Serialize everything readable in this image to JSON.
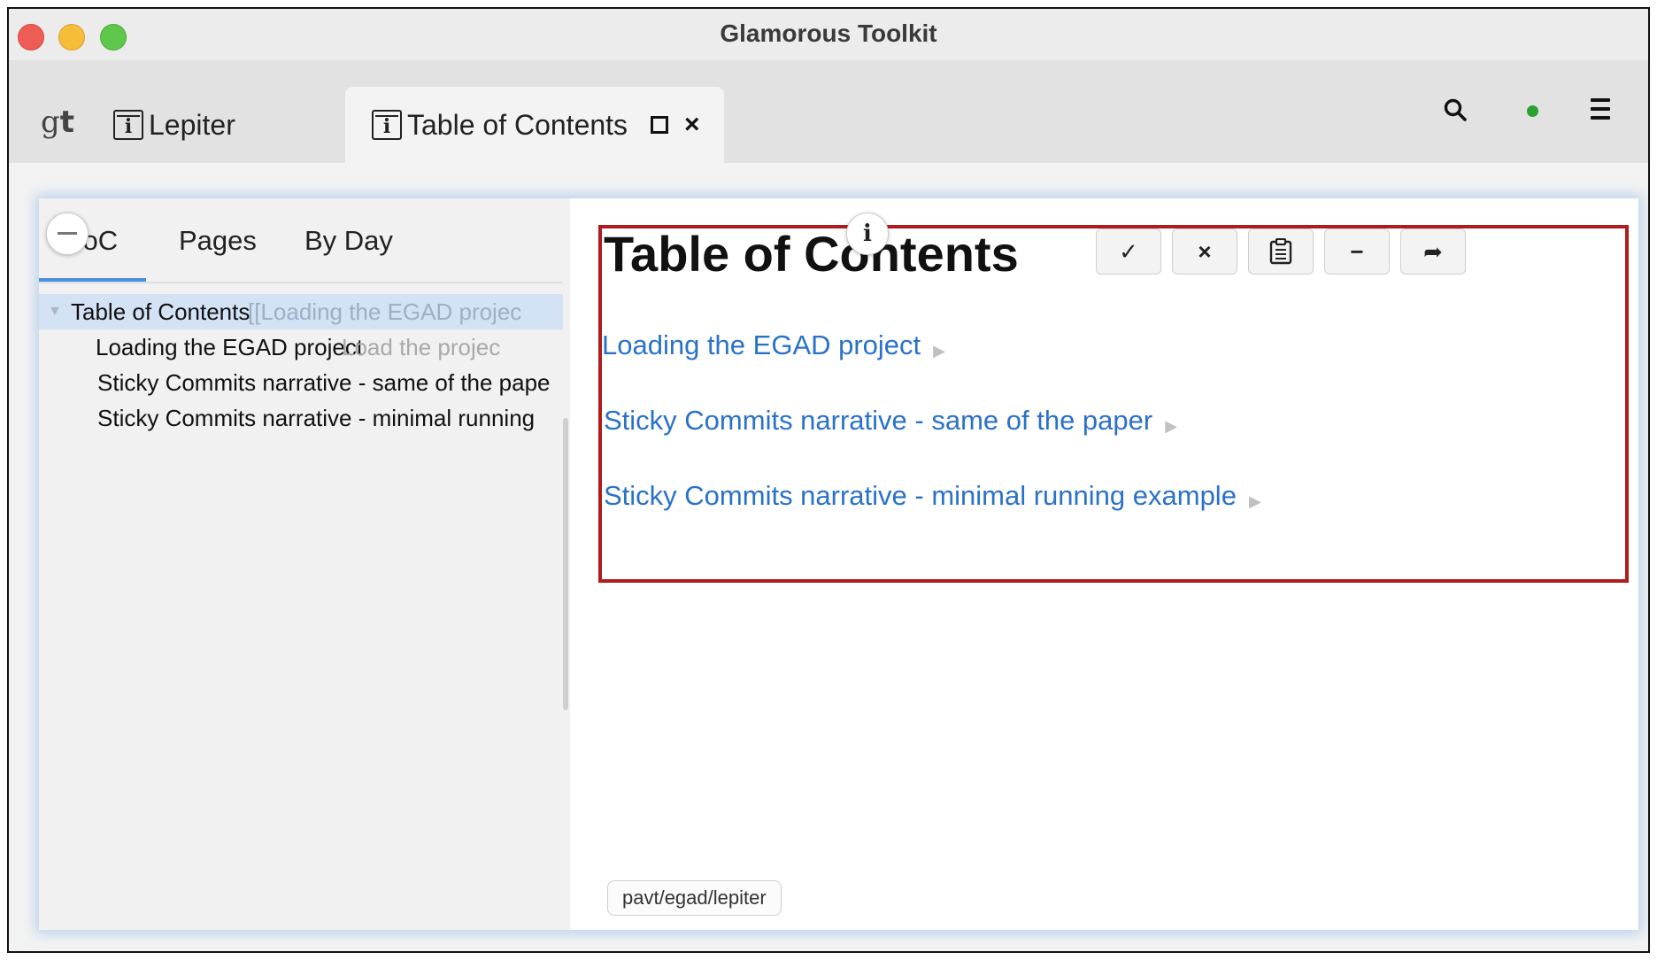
{
  "window": {
    "title": "Glamorous Toolkit"
  },
  "tabbar": {
    "logo": {
      "g": "g",
      "t": "t"
    },
    "tabs": [
      {
        "label": "Lepiter",
        "icon": "lepiter-book-icon"
      },
      {
        "label": "Table of Contents",
        "icon": "lepiter-book-icon",
        "active": true
      }
    ],
    "status_color": "#2aa22f"
  },
  "sidebar": {
    "tabs": [
      {
        "label": "ToC",
        "selected": true
      },
      {
        "label": "Pages"
      },
      {
        "label": "By Day"
      }
    ],
    "tree": [
      {
        "title": "Table of Contents",
        "subtitle": "[[Loading the EGAD projec",
        "selected": true
      },
      {
        "title": "Loading the EGAD project",
        "subtitle": "Load the projec"
      },
      {
        "title": "Sticky Commits narrative - same of the pape",
        "subtitle": ""
      },
      {
        "title": "Sticky Commits narrative - minimal running",
        "subtitle": ""
      }
    ]
  },
  "page": {
    "title": "Table of Contents",
    "toolbar": [
      {
        "name": "accept-button",
        "icon": "check-icon",
        "glyph": "✓"
      },
      {
        "name": "discard-button",
        "icon": "close-icon",
        "glyph": "×"
      },
      {
        "name": "clipboard-button",
        "icon": "clipboard-icon",
        "glyph": ""
      },
      {
        "name": "minimize-button",
        "icon": "minus-icon",
        "glyph": "−"
      },
      {
        "name": "share-button",
        "icon": "share-arrow-icon",
        "glyph": "➦"
      }
    ],
    "links": [
      "Loading the EGAD project",
      "Sticky Commits narrative - same of the paper",
      "Sticky Commits narrative - minimal running example"
    ],
    "link_arrow": "▶",
    "repository": "pavt/egad/lepiter"
  },
  "colors": {
    "link": "#2a72c9",
    "highlight_border": "#b01c1c",
    "accent": "#4a90e2"
  }
}
